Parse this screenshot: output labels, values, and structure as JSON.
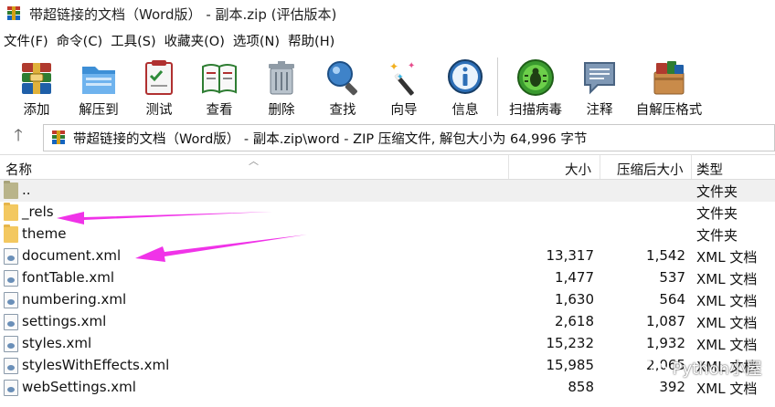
{
  "window": {
    "title": "带超链接的文档（Word版） - 副本.zip (评估版本)"
  },
  "menu": [
    "文件(F)",
    "命令(C)",
    "工具(S)",
    "收藏夹(O)",
    "选项(N)",
    "帮助(H)"
  ],
  "toolbar": [
    {
      "label": "添加",
      "icon": "add-archive-icon"
    },
    {
      "label": "解压到",
      "icon": "extract-to-icon"
    },
    {
      "label": "测试",
      "icon": "test-icon"
    },
    {
      "label": "查看",
      "icon": "view-icon"
    },
    {
      "label": "删除",
      "icon": "delete-icon"
    },
    {
      "label": "查找",
      "icon": "find-icon"
    },
    {
      "label": "向导",
      "icon": "wizard-icon"
    },
    {
      "label": "信息",
      "icon": "info-icon"
    },
    {
      "label": "扫描病毒",
      "icon": "virus-scan-icon"
    },
    {
      "label": "注释",
      "icon": "comment-icon"
    },
    {
      "label": "自解压格式",
      "icon": "sfx-icon"
    }
  ],
  "address": {
    "path": "带超链接的文档（Word版） - 副本.zip\\word - ZIP 压缩文件, 解包大小为 64,996 字节"
  },
  "columns": {
    "name": "名称",
    "size": "大小",
    "packed": "压缩后大小",
    "type": "类型"
  },
  "files": [
    {
      "name": "..",
      "size": "",
      "packed": "",
      "type": "文件夹",
      "kind": "up-folder"
    },
    {
      "name": "_rels",
      "size": "",
      "packed": "",
      "type": "文件夹",
      "kind": "folder"
    },
    {
      "name": "theme",
      "size": "",
      "packed": "",
      "type": "文件夹",
      "kind": "folder"
    },
    {
      "name": "document.xml",
      "size": "13,317",
      "packed": "1,542",
      "type": "XML 文档",
      "kind": "xml"
    },
    {
      "name": "fontTable.xml",
      "size": "1,477",
      "packed": "537",
      "type": "XML 文档",
      "kind": "xml"
    },
    {
      "name": "numbering.xml",
      "size": "1,630",
      "packed": "564",
      "type": "XML 文档",
      "kind": "xml"
    },
    {
      "name": "settings.xml",
      "size": "2,618",
      "packed": "1,087",
      "type": "XML 文档",
      "kind": "xml"
    },
    {
      "name": "styles.xml",
      "size": "15,232",
      "packed": "1,932",
      "type": "XML 文档",
      "kind": "xml"
    },
    {
      "name": "stylesWithEffects.xml",
      "size": "15,985",
      "packed": "2,065",
      "type": "XML 文档",
      "kind": "xml"
    },
    {
      "name": "webSettings.xml",
      "size": "858",
      "packed": "392",
      "type": "XML 文档",
      "kind": "xml"
    }
  ],
  "watermark": {
    "text": "Python小屋"
  },
  "colors": {
    "annotation_arrow": "#f033e8"
  }
}
